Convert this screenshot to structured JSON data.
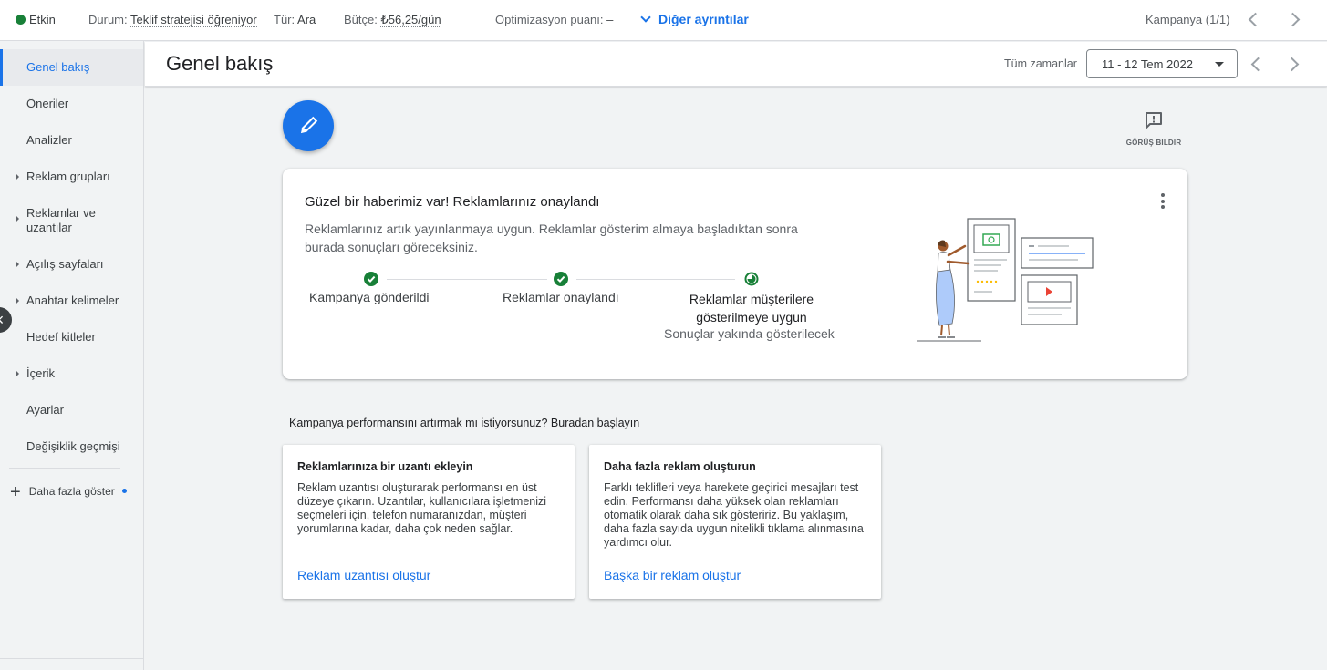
{
  "status_bar": {
    "status": "Etkin",
    "state_label": "Durum:",
    "state_value": "Teklif stratejisi öğreniyor",
    "type_label": "Tür:",
    "type_value": "Ara",
    "budget_label": "Bütçe:",
    "budget_value": "₺56,25/gün",
    "opt_label": "Optimizasyon puanı:",
    "opt_value": "–",
    "more_details": "Diğer ayrıntılar",
    "campaign_counter": "Kampanya (1/1)",
    "status_color": "#188038"
  },
  "sidebar": {
    "items": [
      {
        "label": "Genel bakış",
        "active": true,
        "expandable": false
      },
      {
        "label": "Öneriler",
        "active": false,
        "expandable": false
      },
      {
        "label": "Analizler",
        "active": false,
        "expandable": false
      },
      {
        "label": "Reklam grupları",
        "active": false,
        "expandable": true
      },
      {
        "label": "Reklamlar ve uzantılar",
        "active": false,
        "expandable": true
      },
      {
        "label": "Açılış sayfaları",
        "active": false,
        "expandable": true
      },
      {
        "label": "Anahtar kelimeler",
        "active": false,
        "expandable": true
      },
      {
        "label": "Hedef kitleler",
        "active": false,
        "expandable": false
      },
      {
        "label": "İçerik",
        "active": false,
        "expandable": true
      },
      {
        "label": "Ayarlar",
        "active": false,
        "expandable": false
      },
      {
        "label": "Değişiklik geçmişi",
        "active": false,
        "expandable": false
      }
    ],
    "show_more": "Daha fazla göster",
    "collapse_icon": "close-icon"
  },
  "header": {
    "title": "Genel bakış",
    "range_label": "Tüm zamanlar",
    "date_range": "11 - 12 Tem 2022"
  },
  "feedback": {
    "label": "GÖRÜŞ BİLDİR",
    "icon": "feedback-icon"
  },
  "approval_card": {
    "title": "Güzel bir haberimiz var! Reklamlarınız onaylandı",
    "description": "Reklamlarınız artık yayınlanmaya uygun. Reklamlar gösterim almaya başladıktan sonra burada sonuçları göreceksiniz.",
    "steps": [
      {
        "label": "Kampanya gönderildi",
        "state": "done"
      },
      {
        "label": "Reklamlar onaylandı",
        "state": "done"
      },
      {
        "label": "Reklamlar müşterilere gösterilmeye uygun",
        "state": "in-progress",
        "sub": "Sonuçlar yakında gösterilecek"
      }
    ]
  },
  "suggestions": {
    "prompt": "Kampanya performansını artırmak mı istiyorsunuz? Buradan başlayın",
    "cards": [
      {
        "title": "Reklamlarınıza bir uzantı ekleyin",
        "body": "Reklam uzantısı oluşturarak performansı en üst düzeye çıkarın. Uzantılar, kullanıcılara işletmenizi seçmeleri için, telefon numaranızdan, müşteri yorumlarına kadar, daha çok neden sağlar.",
        "link": "Reklam uzantısı oluştur"
      },
      {
        "title": "Daha fazla reklam oluşturun",
        "body": "Farklı teklifleri veya harekete geçirici mesajları test edin. Performansı daha yüksek olan reklamları otomatik olarak daha sık gösteririz. Bu yaklaşım, daha fazla sayıda uygun nitelikli tıklama alınmasına yardımcı olur.",
        "link": "Başka bir reklam oluştur"
      }
    ]
  },
  "colors": {
    "accent": "#1a73e8",
    "success": "#188038"
  }
}
